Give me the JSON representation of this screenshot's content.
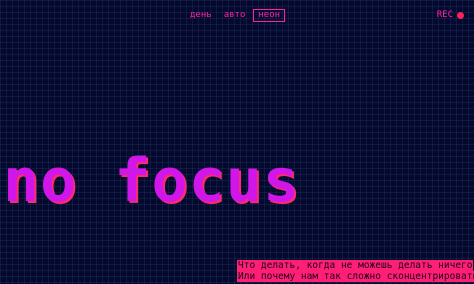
{
  "nav": {
    "items": [
      {
        "label": "день"
      },
      {
        "label": "авто"
      },
      {
        "label": "неон"
      }
    ]
  },
  "rec": {
    "label": "REC"
  },
  "headline": "no focus",
  "caption": {
    "lines": [
      "Что делать, когда не можешь делать ничего",
      "Или почему нам так сложно сконцентрироваться,"
    ]
  },
  "colors": {
    "background": "#040a2e",
    "accent": "#ff1fa0",
    "headline": "#d016e8",
    "caption_background": "#ff1f74"
  }
}
